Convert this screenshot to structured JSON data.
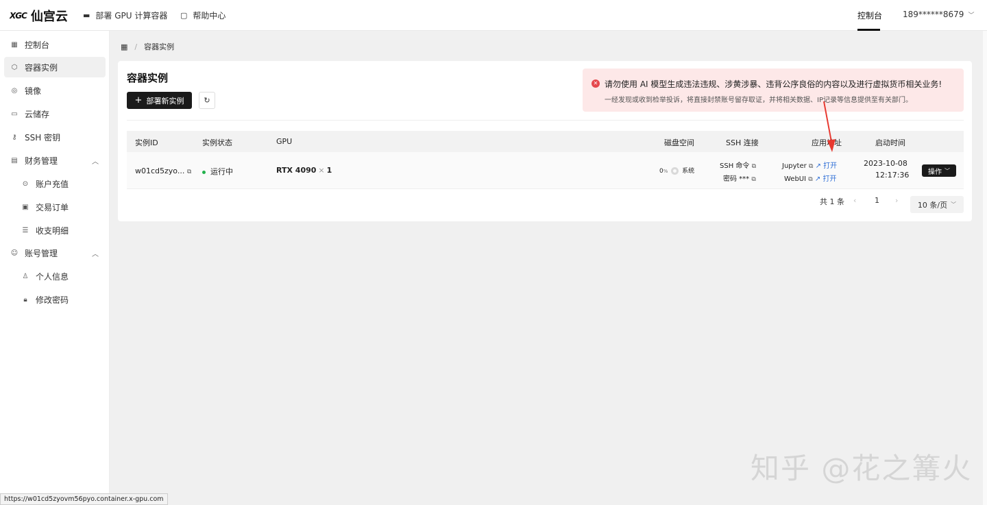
{
  "brand": {
    "mark": "XGC",
    "name": "仙宫云"
  },
  "topnav": {
    "deploy": "部署 GPU 计算容器",
    "help": "帮助中心",
    "console": "控制台",
    "user": "189******8679"
  },
  "sidebar": {
    "items": [
      {
        "label": "控制台",
        "icon": "dashboard-icon"
      },
      {
        "label": "容器实例",
        "icon": "container-icon",
        "active": true
      },
      {
        "label": "镜像",
        "icon": "image-icon"
      },
      {
        "label": "云储存",
        "icon": "storage-icon"
      },
      {
        "label": "SSH 密钥",
        "icon": "key-icon"
      },
      {
        "label": "财务管理",
        "icon": "finance-icon",
        "expanded": true
      },
      {
        "label": "账号管理",
        "icon": "account-icon",
        "expanded": true
      }
    ],
    "finance_sub": [
      {
        "label": "账户充值",
        "icon": "recharge-icon"
      },
      {
        "label": "交易订单",
        "icon": "order-icon"
      },
      {
        "label": "收支明细",
        "icon": "list-icon"
      }
    ],
    "account_sub": [
      {
        "label": "个人信息",
        "icon": "user-icon"
      },
      {
        "label": "修改密码",
        "icon": "lock-icon"
      }
    ]
  },
  "breadcrumb": {
    "current": "容器实例"
  },
  "page": {
    "title": "容器实例",
    "deploy_button": "部署新实例"
  },
  "alert": {
    "title": "请勿使用 AI 模型生成违法违规、涉黄涉暴、违背公序良俗的内容以及进行虚拟货币相关业务!",
    "desc": "一经发现或收到检举投诉，将直接封禁账号留存取证，并将相关数据、IP记录等信息提供至有关部门。"
  },
  "table": {
    "headers": {
      "id": "实例ID",
      "status": "实例状态",
      "gpu": "GPU",
      "disk": "磁盘空间",
      "ssh": "SSH 连接",
      "app": "应用地址",
      "start": "启动时间"
    },
    "rows": [
      {
        "id": "w01cd5zyo...",
        "status": "运行中",
        "gpu_name": "RTX 4090",
        "gpu_x": "×",
        "gpu_count": "1",
        "disk_pct": "0",
        "disk_unit": "%",
        "disk_label": "系统",
        "ssh_cmd": "SSH 命令",
        "ssh_pwd": "密码 ***",
        "app1": "Jupyter",
        "app2": "WebUI",
        "open": "打开",
        "start_date": "2023-10-08",
        "start_time": "12:17:36",
        "op": "操作"
      }
    ]
  },
  "pagination": {
    "total": "共 1 条",
    "current": "1",
    "size": "10 条/页"
  },
  "status_url": "https://w01cd5zyovm56pyo.container.x-gpu.com",
  "watermark": "知乎 @花之篝火",
  "colors": {
    "accent": "#1a1a1a",
    "running": "#22b14c",
    "alert_bg": "#fde8e8",
    "link": "#2f6fd6",
    "arrow": "#e8382f"
  }
}
